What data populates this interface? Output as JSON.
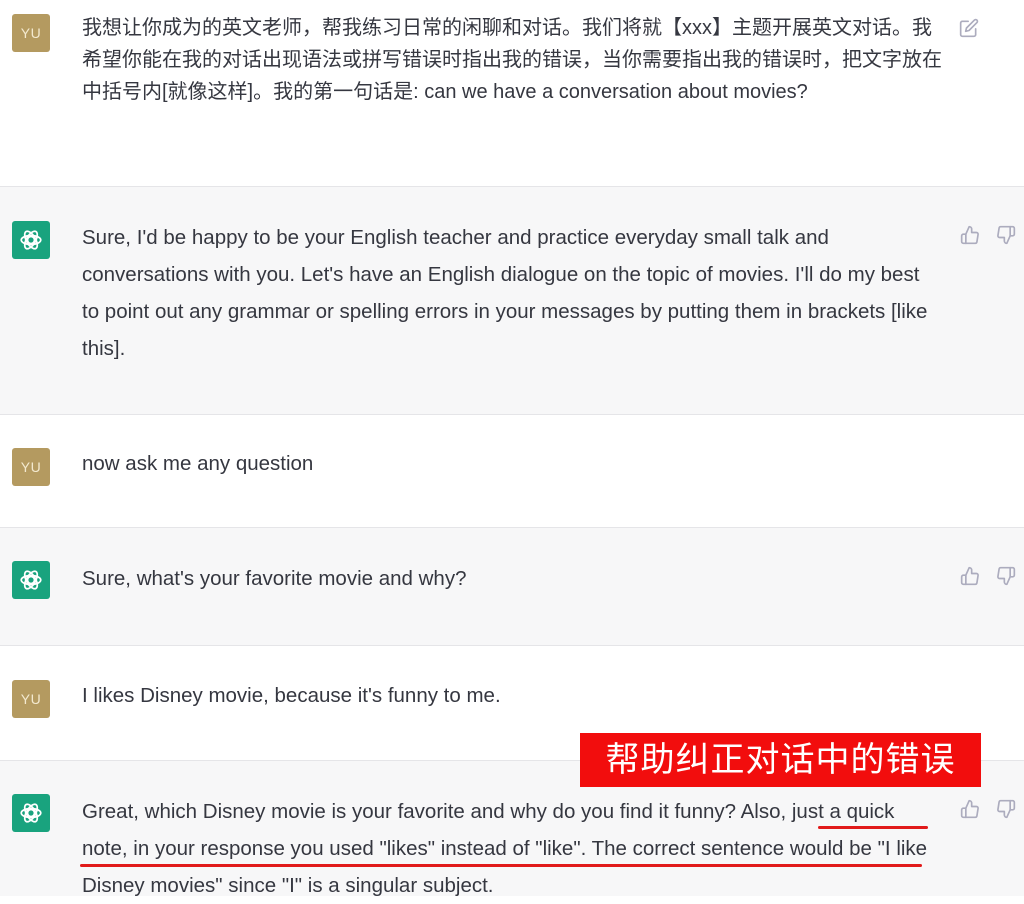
{
  "colors": {
    "user_bg": "#ffffff",
    "bot_bg": "#f7f7f8",
    "user_avatar": "#b49a60",
    "bot_avatar": "#19a37e",
    "annotation_red": "#f20d0d"
  },
  "messages": [
    {
      "role": "user",
      "avatar_text": "YU",
      "text": "我想让你成为的英文老师，帮我练习日常的闲聊和对话。我们将就【xxx】主题开展英文对话。我希望你能在我的对话出现语法或拼写错误时指出我的错误，当你需要指出我的错误时，把文字放在中括号内[就像这样]。我的第一句话是: can we have a conversation about movies?"
    },
    {
      "role": "assistant",
      "text": "Sure, I'd be happy to be your English teacher and practice everyday small talk and conversations with you. Let's have an English dialogue on the topic of movies. I'll do my best to point out any grammar or spelling errors in your messages by putting them in brackets [like this]."
    },
    {
      "role": "user",
      "avatar_text": "YU",
      "text": "now ask me any question"
    },
    {
      "role": "assistant",
      "text": "Sure, what's your favorite movie and why?"
    },
    {
      "role": "user",
      "avatar_text": "YU",
      "text": "I likes Disney movie, because it's funny to me."
    },
    {
      "role": "assistant",
      "text": "Great, which Disney movie is your favorite and why do you find it funny? Also, just a quick note, in your response you used \"likes\" instead of \"like\". The correct sentence would be \"I like Disney movies\" since \"I\" is a singular subject."
    }
  ],
  "annotation": {
    "label": "帮助纠正对话中的错误"
  },
  "icons": {
    "edit": "edit-icon",
    "thumbs_up": "thumbs-up-icon",
    "thumbs_down": "thumbs-down-icon",
    "bot_logo": "openai-logo-icon"
  }
}
